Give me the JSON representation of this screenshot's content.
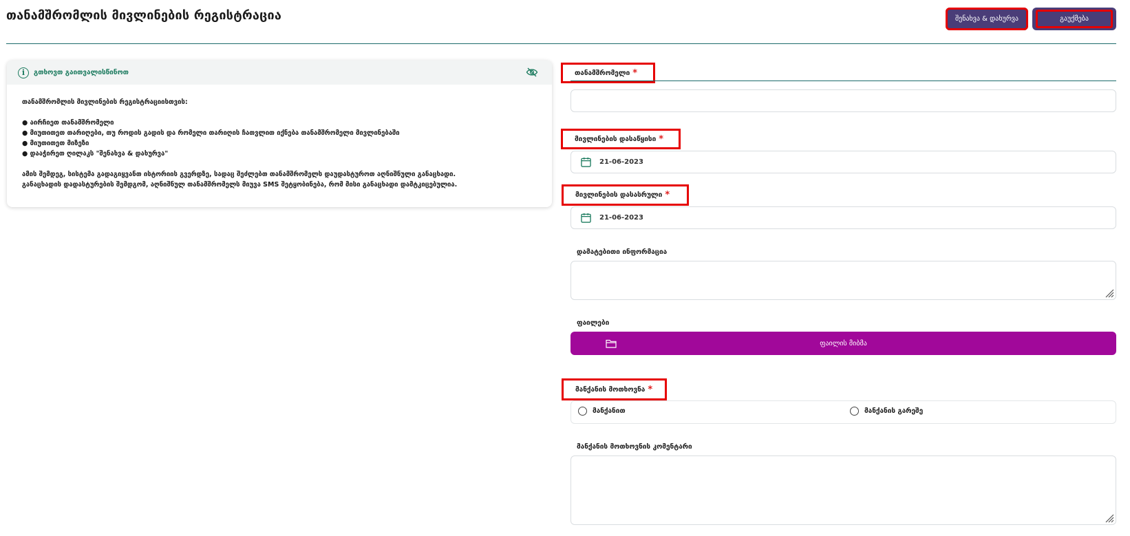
{
  "header": {
    "title": "თანამშრომლის მივლინების რეგისტრაცია",
    "save_label": "შენახვა & დახურვა",
    "cancel_label": "გაუქმება"
  },
  "info": {
    "title": "გთხოვთ გაითვალისწინოთ",
    "intro": "თანამშრომლის მივლინების რეგისტრაციისთვის:",
    "steps": [
      "● აირჩიეთ თანამშრომელი",
      "● მიუთითეთ თარიღები, თუ როდის გადის და რომელი თარიღის ჩათვლით იქნება თანამშრომელი მივლინებაში",
      "● მიუთითეთ მიზეზი",
      "● დააჭირეთ ღილაკს \"შენახვა & დახურვა\""
    ],
    "note_1": "ამის შემდეგ, სისტემა გადაგიყვანთ ისტორიის გვერდზე, სადაც შეძლებთ თანამშრომელს დაუდასტუროთ აღნიშნული განაცხადი.",
    "note_2": "განაცხადის დადასტურების შემდგომ, აღნიშნულ თანამშრომელს მიუვა SMS შეტყობინება, რომ მისი განაცხადი დამტკიცებულია."
  },
  "form": {
    "employee_label": "თანამშრომელი",
    "employee_value": "",
    "start_label": "მივლინების დასაწყისი",
    "start_value": "21-06-2023",
    "end_label": "მივლინების დასასრული",
    "end_value": "21-06-2023",
    "extra_label": "დამატებითი ინფორმაცია",
    "extra_value": "",
    "files_label": "ფაილები",
    "upload_label": "ფაილის მიბმა",
    "car_label": "მანქანის მოთხოვნა",
    "car_options": [
      "მანქანით",
      "მანქანის გარეშე"
    ],
    "car_comment_label": "მანქანის მოთხოვნის კომენტარი",
    "car_comment_value": "",
    "required_mark": "*"
  },
  "colors": {
    "accent": "#1c6b6b",
    "button": "#4a3d78",
    "upload": "#a1089a",
    "required": "#e02020",
    "highlight": "#e60000"
  }
}
